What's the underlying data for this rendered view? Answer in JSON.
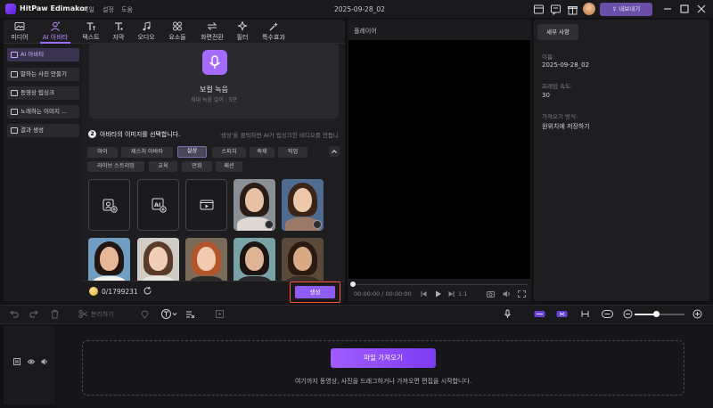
{
  "app": {
    "name": "HitPaw Edimakor",
    "menu": [
      "파일",
      "설정",
      "도움"
    ],
    "doc_title": "2025-09-28_02",
    "export_label": "내보내기"
  },
  "tabs": [
    {
      "label": "미디어",
      "icon": "media-icon"
    },
    {
      "label": "AI 아바타",
      "icon": "ai-avatar-icon",
      "active": true
    },
    {
      "label": "텍스트",
      "icon": "text-icon"
    },
    {
      "label": "자막",
      "icon": "subtitle-icon"
    },
    {
      "label": "오디오",
      "icon": "audio-icon"
    },
    {
      "label": "요소들",
      "icon": "elements-icon"
    },
    {
      "label": "화면전환",
      "icon": "transition-icon"
    },
    {
      "label": "필터",
      "icon": "filter-icon"
    },
    {
      "label": "특수효과",
      "icon": "effects-icon"
    }
  ],
  "sidebar": [
    {
      "label": "AI 아바타",
      "active": true
    },
    {
      "label": "말하는 사진 만들기"
    },
    {
      "label": "동영상 립싱크"
    },
    {
      "label": "노래하는 이미지 ..."
    },
    {
      "label": "결과 생성"
    }
  ],
  "record": {
    "title": "보컬 녹음",
    "subtitle": "최대 녹음 길이 : 5분"
  },
  "step2": {
    "number": "2",
    "title": "아바타의 이미지를 선택합니다.",
    "hint": "'생성'을 클릭하면 AI가 립싱크한 비디오를 만듭니다."
  },
  "chips_row1": [
    "마이",
    "제스처 아바타",
    "실상",
    "스피치",
    "축제",
    "직업"
  ],
  "chips_row2": [
    "라이브 스트리밍",
    "교육",
    "만화",
    "패션"
  ],
  "active_chip": "실상",
  "credits": "0/1799231",
  "generate_label": "생성",
  "player": {
    "label": "플레이어",
    "time": "00:00:00 / 00:00:00",
    "speed": "1:1"
  },
  "details": {
    "tab": "세부 사항",
    "fields": [
      {
        "label": "이름:",
        "value": "2025-09-28_02"
      },
      {
        "label": "프레임 속도:",
        "value": "30"
      },
      {
        "label": "가져오기 방식:",
        "value": "원위치에 저장하기"
      }
    ]
  },
  "toolbar": {
    "split_label": "분리하기",
    "zoom": 0.42
  },
  "timeline": {
    "import_label": "파일 가져오기",
    "hint": "여기까지 동영상, 사진을 드래그하거나 가져오면 편집을 시작합니다."
  },
  "colors": {
    "accent": "#9b6bff",
    "highlight": "#ff5533"
  }
}
